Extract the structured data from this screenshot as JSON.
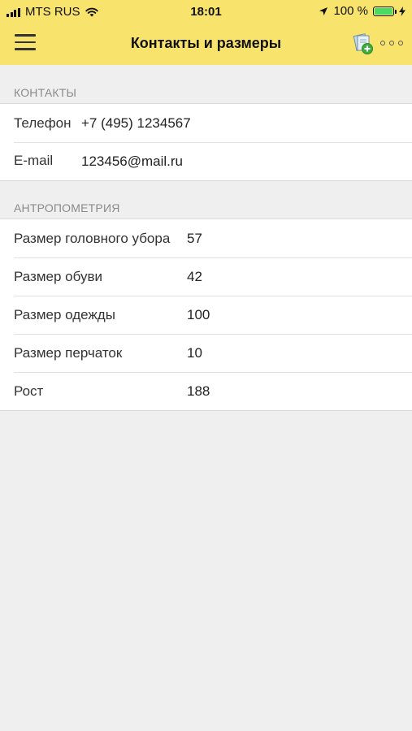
{
  "status_bar": {
    "carrier": "MTS RUS",
    "time": "18:01",
    "battery": "100 %"
  },
  "nav": {
    "title": "Контакты и размеры"
  },
  "contacts": {
    "header": "КОНТАКТЫ",
    "rows": [
      {
        "label": "Телефон",
        "value": "+7 (495) 1234567"
      },
      {
        "label": "E-mail",
        "value": "123456@mail.ru"
      }
    ]
  },
  "anthropometry": {
    "header": "АНТРОПОМЕТРИЯ",
    "rows": [
      {
        "label": "Размер головного убора",
        "value": "57"
      },
      {
        "label": "Размер обуви",
        "value": "42"
      },
      {
        "label": "Размер одежды",
        "value": "100"
      },
      {
        "label": "Размер перчаток",
        "value": "10"
      },
      {
        "label": "Рост",
        "value": "188"
      }
    ]
  },
  "colors": {
    "accent": "#f8e36c",
    "background": "#efefef",
    "battery": "#4cd964"
  },
  "icons": [
    "signal-icon",
    "wifi-icon",
    "location-arrow-icon",
    "battery-icon",
    "charging-bolt-icon",
    "hamburger-menu-icon",
    "add-document-icon",
    "more-dots-icon"
  ]
}
